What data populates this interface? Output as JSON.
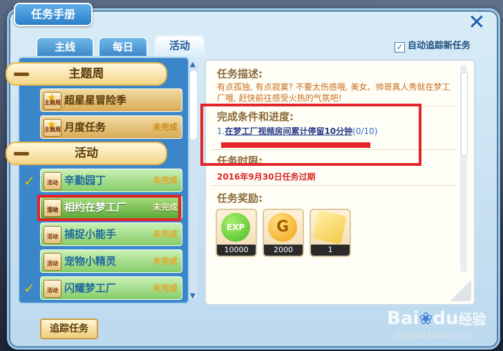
{
  "window": {
    "title": "任务手册"
  },
  "tabs": [
    {
      "label": "主线",
      "active": false
    },
    {
      "label": "每日",
      "active": false
    },
    {
      "label": "活动",
      "active": true
    }
  ],
  "auto_track": {
    "label": "自动追踪新任务",
    "checked": true
  },
  "categories": [
    {
      "label": "主题周"
    },
    {
      "label": "活动"
    }
  ],
  "tasks": [
    {
      "icon_label": "主题周",
      "name": "超星星冒险季",
      "status": ""
    },
    {
      "icon_label": "主题周",
      "name": "月度任务",
      "status": "未完成"
    },
    {
      "icon_label": "活动",
      "name": "辛勤园丁",
      "status": "未完成",
      "checked": true
    },
    {
      "icon_label": "活动",
      "name": "相约在梦工厂",
      "status": "未完成",
      "selected": true
    },
    {
      "icon_label": "活动",
      "name": "捕捉小能手",
      "status": "未完成"
    },
    {
      "icon_label": "活动",
      "name": "宠物小精灵",
      "status": "未完成"
    },
    {
      "icon_label": "活动",
      "name": "闪耀梦工厂",
      "status": "未完成",
      "checked": true
    }
  ],
  "track_button": "追踪任务",
  "detail": {
    "desc_title": "任务描述:",
    "desc_text": "有点孤独, 有点寂寞? 不要太伤感哦, 美女、帅哥真人秀就在梦工厂哦, 赶快前往感受火热的气氛吧!",
    "cond_title": "完成条件和进度:",
    "cond_num": "1.",
    "cond_text": "在梦工厂视频房间累计停留10分钟",
    "cond_progress": "(0/10)",
    "time_title": "任务时限:",
    "deadline": "2016年9月30日任务过期",
    "reward_title": "任务奖励:"
  },
  "rewards": [
    {
      "icon": "exp-icon",
      "label": "EXP",
      "amount": "10000",
      "color": "#4dbb2a"
    },
    {
      "icon": "gold-coin-icon",
      "label": "G",
      "amount": "2000",
      "color": "#f0a21a"
    },
    {
      "icon": "puzzle-icon",
      "label": "",
      "amount": "1",
      "color": "#f4c84a"
    }
  ],
  "watermark": {
    "logo": "Bai",
    "logo2": "du",
    "cn": "经验",
    "url": "jingyan.baidu.com"
  },
  "icons": {
    "close": "close-icon",
    "check": "checkmark-icon"
  }
}
